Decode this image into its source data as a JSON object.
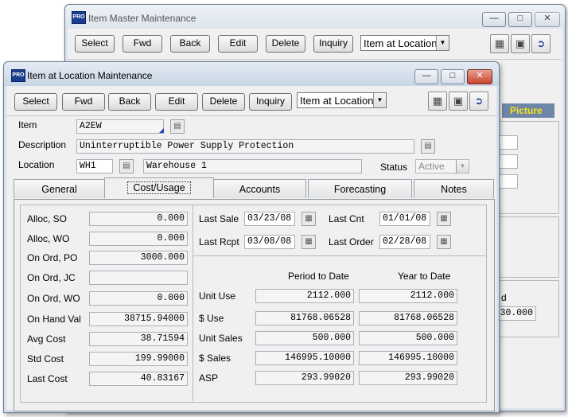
{
  "back_window": {
    "title": "Item Master Maintenance",
    "toolbar": {
      "select": "Select",
      "fwd": "Fwd",
      "back": "Back",
      "edit": "Edit",
      "delete": "Delete",
      "inquiry": "Inquiry",
      "dropdown_value": "Item at Location"
    },
    "picture_label": "Picture",
    "partial_label": "d",
    "partial_value": "30.000"
  },
  "front_window": {
    "title": "Item at Location Maintenance",
    "toolbar": {
      "select": "Select",
      "fwd": "Fwd",
      "back": "Back",
      "edit": "Edit",
      "delete": "Delete",
      "inquiry": "Inquiry",
      "dropdown_value": "Item at Location"
    },
    "item_label": "Item",
    "item_value": "A2EW",
    "description_label": "Description",
    "description_value": "Uninterruptible Power Supply Protection",
    "location_label": "Location",
    "location_code": "WH1",
    "location_name": "Warehouse 1",
    "status_label": "Status",
    "status_value": "Active",
    "tabs": [
      "General",
      "Cost/Usage",
      "Accounts",
      "Forecasting",
      "Notes"
    ],
    "left_fields": [
      {
        "label": "Alloc, SO",
        "value": "0.000"
      },
      {
        "label": "Alloc, WO",
        "value": "0.000"
      },
      {
        "label": "On Ord, PO",
        "value": "3000.000"
      },
      {
        "label": "On Ord, JC",
        "value": ""
      },
      {
        "label": "On Ord, WO",
        "value": "0.000"
      },
      {
        "label": "On Hand Val",
        "value": "38715.94000"
      },
      {
        "label": "Avg Cost",
        "value": "38.71594"
      },
      {
        "label": "Std Cost",
        "value": "199.99000"
      },
      {
        "label": "Last Cost",
        "value": "40.83167"
      }
    ],
    "dates": {
      "last_sale_label": "Last Sale",
      "last_sale": "03/23/08",
      "last_rcpt_label": "Last Rcpt",
      "last_rcpt": "03/08/08",
      "last_cnt_label": "Last Cnt",
      "last_cnt": "01/01/08",
      "last_order_label": "Last Order",
      "last_order": "02/28/08"
    },
    "usage_headers": {
      "period": "Period to Date",
      "year": "Year to Date"
    },
    "usage_rows": [
      {
        "label": "Unit Use",
        "period": "2112.000",
        "year": "2112.000"
      },
      {
        "label": "$ Use",
        "period": "81768.06528",
        "year": "81768.06528"
      },
      {
        "label": "Unit Sales",
        "period": "500.000",
        "year": "500.000"
      },
      {
        "label": "$ Sales",
        "period": "146995.10000",
        "year": "146995.10000"
      },
      {
        "label": "ASP",
        "period": "293.99020",
        "year": "293.99020"
      }
    ]
  },
  "colors": {
    "picture_label": "#f5e21a",
    "close_button": "#c74530"
  }
}
